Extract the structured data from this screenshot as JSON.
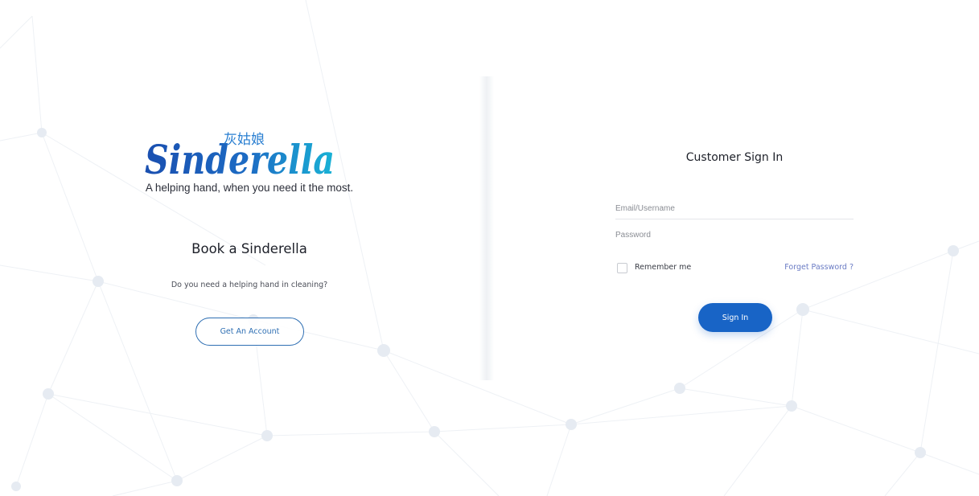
{
  "brand": {
    "logo_text": "Sinderella",
    "logo_chinese": "灰姑娘",
    "tagline": "A helping hand, when you need it the most.",
    "colors": {
      "logo_dark": "#1a4fb0",
      "logo_light": "#19b3d6",
      "chinese_text": "#2a7fd1"
    }
  },
  "book": {
    "title": "Book a Sinderella",
    "subtitle": "Do you need a helping hand in cleaning?",
    "cta_label": "Get An Account"
  },
  "signin": {
    "title": "Customer Sign In",
    "email_placeholder": "Email/Username",
    "password_placeholder": "Password",
    "remember_label": "Remember me",
    "forget_label": "Forget Password ?",
    "submit_label": "Sign In",
    "accent_color": "#1864c6"
  },
  "background": {
    "pattern": "network-mesh",
    "node_color": "#e6ebf2",
    "line_color": "#eef1f5"
  }
}
